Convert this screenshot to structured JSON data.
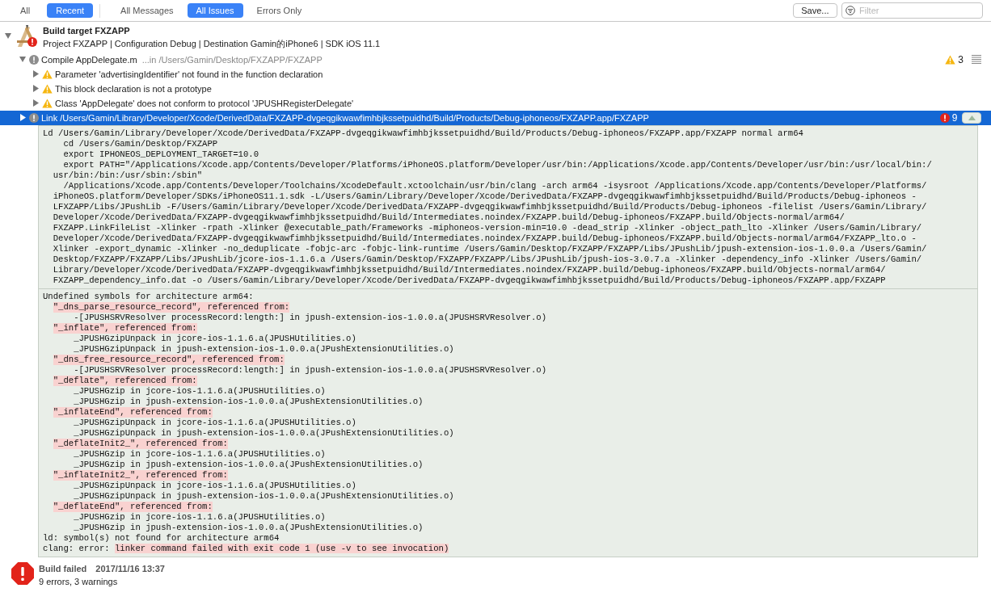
{
  "toolbar": {
    "scope_buttons": [
      {
        "label": "All",
        "selected": false
      },
      {
        "label": "Recent",
        "selected": true
      }
    ],
    "filter_buttons": [
      {
        "label": "All Messages",
        "selected": false
      },
      {
        "label": "All Issues",
        "selected": true
      },
      {
        "label": "Errors Only",
        "selected": false
      }
    ],
    "save_button": "Save...",
    "filter": {
      "placeholder": "Filter"
    }
  },
  "issues": [
    {
      "kind": "target",
      "title": "Build target FXZAPP",
      "subtitle": "Project FXZAPP | Configuration Debug | Destination Gamin的iPhone6 | SDK iOS 11.1",
      "expanded": true,
      "selected": false,
      "children": [
        {
          "kind": "step",
          "title": "Compile AppDelegate.m",
          "detail": "...in /Users/Gamin/Desktop/FXZAPP/FXZAPP",
          "expanded": true,
          "selected": false,
          "transcript_open": false,
          "badge": {
            "kind": "warning",
            "count": "3"
          },
          "children": [
            {
              "kind": "warning",
              "title": "Parameter 'advertisingIdentifier' not found in the function declaration",
              "expanded": false,
              "selected": false
            },
            {
              "kind": "warning",
              "title": "This block declaration is not a prototype",
              "expanded": false,
              "selected": false
            },
            {
              "kind": "warning",
              "title": "Class 'AppDelegate' does not conform to protocol 'JPUSHRegisterDelegate'",
              "expanded": false,
              "selected": false
            }
          ]
        },
        {
          "kind": "step",
          "title": "Link /Users/Gamin/Library/Developer/Xcode/DerivedData/FXZAPP-dvgeqgikwawfimhbjkssetpuidhd/Build/Products/Debug-iphoneos/FXZAPP.app/FXZAPP",
          "expanded": false,
          "selected": true,
          "transcript_open": true,
          "badge": {
            "kind": "error",
            "count": "9"
          },
          "log": [
            [
              {
                "kind": "command",
                "text": "Ld /Users/Gamin/Library/Developer/Xcode/DerivedData/FXZAPP-dvgeqgikwawfimhbjkssetpuidhd/Build/Products/Debug-iphoneos/FXZAPP.app/FXZAPP normal arm64"
              },
              {
                "kind": "sub",
                "text": "cd /Users/Gamin/Desktop/FXZAPP"
              },
              {
                "kind": "sub",
                "text": "export IPHONEOS_DEPLOYMENT_TARGET=10.0"
              },
              {
                "kind": "sub",
                "text": "export PATH=\"/Applications/Xcode.app/Contents/Developer/Platforms/iPhoneOS.platform/Developer/usr/bin:/Applications/Xcode.app/Contents/Developer/usr/bin:/usr/local/bin:/"
              },
              {
                "kind": "cont",
                "text": "usr/bin:/bin:/usr/sbin:/sbin\""
              },
              {
                "kind": "sub",
                "text": "/Applications/Xcode.app/Contents/Developer/Toolchains/XcodeDefault.xctoolchain/usr/bin/clang -arch arm64 -isysroot /Applications/Xcode.app/Contents/Developer/Platforms/"
              },
              {
                "kind": "cont",
                "text": "iPhoneOS.platform/Developer/SDKs/iPhoneOS11.1.sdk -L/Users/Gamin/Library/Developer/Xcode/DerivedData/FXZAPP-dvgeqgikwawfimhbjkssetpuidhd/Build/Products/Debug-iphoneos -"
              },
              {
                "kind": "cont",
                "text": "LFXZAPP/Libs/JPushLib -F/Users/Gamin/Library/Developer/Xcode/DerivedData/FXZAPP-dvgeqgikwawfimhbjkssetpuidhd/Build/Products/Debug-iphoneos -filelist /Users/Gamin/Library/"
              },
              {
                "kind": "cont",
                "text": "Developer/Xcode/DerivedData/FXZAPP-dvgeqgikwawfimhbjkssetpuidhd/Build/Intermediates.noindex/FXZAPP.build/Debug-iphoneos/FXZAPP.build/Objects-normal/arm64/"
              },
              {
                "kind": "cont",
                "text": "FXZAPP.LinkFileList -Xlinker -rpath -Xlinker @executable_path/Frameworks -miphoneos-version-min=10.0 -dead_strip -Xlinker -object_path_lto -Xlinker /Users/Gamin/Library/"
              },
              {
                "kind": "cont",
                "text": "Developer/Xcode/DerivedData/FXZAPP-dvgeqgikwawfimhbjkssetpuidhd/Build/Intermediates.noindex/FXZAPP.build/Debug-iphoneos/FXZAPP.build/Objects-normal/arm64/FXZAPP_lto.o -"
              },
              {
                "kind": "cont",
                "text": "Xlinker -export_dynamic -Xlinker -no_deduplicate -fobjc-arc -fobjc-link-runtime /Users/Gamin/Desktop/FXZAPP/FXZAPP/Libs/JPushLib/jpush-extension-ios-1.0.0.a /Users/Gamin/"
              },
              {
                "kind": "cont",
                "text": "Desktop/FXZAPP/FXZAPP/Libs/JPushLib/jcore-ios-1.1.6.a /Users/Gamin/Desktop/FXZAPP/FXZAPP/Libs/JPushLib/jpush-ios-3.0.7.a -Xlinker -dependency_info -Xlinker /Users/Gamin/"
              },
              {
                "kind": "cont",
                "text": "Library/Developer/Xcode/DerivedData/FXZAPP-dvgeqgikwawfimhbjkssetpuidhd/Build/Intermediates.noindex/FXZAPP.build/Debug-iphoneos/FXZAPP.build/Objects-normal/arm64/"
              },
              {
                "kind": "cont",
                "text": "FXZAPP_dependency_info.dat -o /Users/Gamin/Library/Developer/Xcode/DerivedData/FXZAPP-dvgeqgikwawfimhbjkssetpuidhd/Build/Products/Debug-iphoneos/FXZAPP.app/FXZAPP"
              }
            ],
            [
              {
                "kind": "plain",
                "text": "Undefined symbols for architecture arm64:"
              },
              {
                "kind": "symbol",
                "text": "\"_dns_parse_resource_record\", referenced from:"
              },
              {
                "kind": "ref",
                "text": "-[JPUSHSRVResolver processRecord:length:] in jpush-extension-ios-1.0.0.a(JPUSHSRVResolver.o)"
              },
              {
                "kind": "symbol",
                "text": "\"_inflate\", referenced from:"
              },
              {
                "kind": "ref",
                "text": "_JPUSHGzipUnpack in jcore-ios-1.1.6.a(JPUSHUtilities.o)"
              },
              {
                "kind": "ref",
                "text": "_JPUSHGzipUnpack in jpush-extension-ios-1.0.0.a(JPushExtensionUtilities.o)"
              },
              {
                "kind": "symbol",
                "text": "\"_dns_free_resource_record\", referenced from:"
              },
              {
                "kind": "ref",
                "text": "-[JPUSHSRVResolver processRecord:length:] in jpush-extension-ios-1.0.0.a(JPUSHSRVResolver.o)"
              },
              {
                "kind": "symbol",
                "text": "\"_deflate\", referenced from:"
              },
              {
                "kind": "ref",
                "text": "_JPUSHGzip in jcore-ios-1.1.6.a(JPUSHUtilities.o)"
              },
              {
                "kind": "ref",
                "text": "_JPUSHGzip in jpush-extension-ios-1.0.0.a(JPushExtensionUtilities.o)"
              },
              {
                "kind": "symbol",
                "text": "\"_inflateEnd\", referenced from:"
              },
              {
                "kind": "ref",
                "text": "_JPUSHGzipUnpack in jcore-ios-1.1.6.a(JPUSHUtilities.o)"
              },
              {
                "kind": "ref",
                "text": "_JPUSHGzipUnpack in jpush-extension-ios-1.0.0.a(JPushExtensionUtilities.o)"
              },
              {
                "kind": "symbol",
                "text": "\"_deflateInit2_\", referenced from:"
              },
              {
                "kind": "ref",
                "text": "_JPUSHGzip in jcore-ios-1.1.6.a(JPUSHUtilities.o)"
              },
              {
                "kind": "ref",
                "text": "_JPUSHGzip in jpush-extension-ios-1.0.0.a(JPushExtensionUtilities.o)"
              },
              {
                "kind": "symbol",
                "text": "\"_inflateInit2_\", referenced from:"
              },
              {
                "kind": "ref",
                "text": "_JPUSHGzipUnpack in jcore-ios-1.1.6.a(JPUSHUtilities.o)"
              },
              {
                "kind": "ref",
                "text": "_JPUSHGzipUnpack in jpush-extension-ios-1.0.0.a(JPushExtensionUtilities.o)"
              },
              {
                "kind": "symbol",
                "text": "\"_deflateEnd\", referenced from:"
              },
              {
                "kind": "ref",
                "text": "_JPUSHGzip in jcore-ios-1.1.6.a(JPUSHUtilities.o)"
              },
              {
                "kind": "ref",
                "text": "_JPUSHGzip in jpush-extension-ios-1.0.0.a(JPushExtensionUtilities.o)"
              },
              {
                "kind": "plain",
                "text": "ld: symbol(s) not found for architecture arm64"
              },
              {
                "kind": "error",
                "text": "clang: error:",
                "message": "linker command failed with exit code 1 (use -v to see invocation)"
              }
            ]
          ]
        }
      ]
    }
  ],
  "result": {
    "title": "Build failed",
    "time": "2017/11/16 13:37",
    "summary": "9 errors, 3 warnings"
  }
}
